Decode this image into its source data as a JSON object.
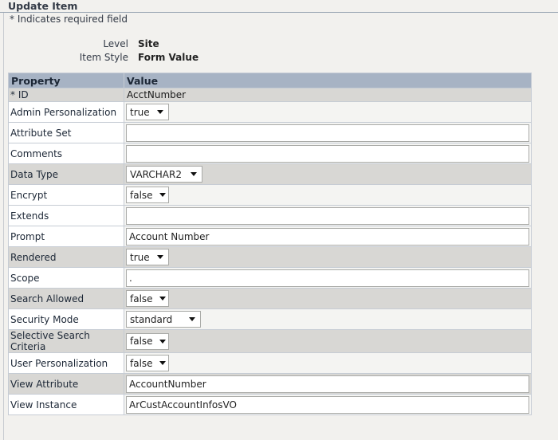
{
  "page": {
    "title": "Update Item",
    "required_note": "* Indicates required field"
  },
  "meta": {
    "level_label": "Level",
    "level_value": "Site",
    "style_label": "Item Style",
    "style_value": "Form Value"
  },
  "table": {
    "headers": [
      "Property",
      "Value"
    ],
    "rows": [
      {
        "property": "* ID",
        "value": "AcctNumber"
      },
      {
        "property": "Admin Personalization",
        "value": "true"
      },
      {
        "property": "Attribute Set",
        "value": ""
      },
      {
        "property": "Comments",
        "value": ""
      },
      {
        "property": "Data Type",
        "value": "VARCHAR2"
      },
      {
        "property": "Encrypt",
        "value": "false"
      },
      {
        "property": "Extends",
        "value": ""
      },
      {
        "property": "Prompt",
        "value": "Account Number"
      },
      {
        "property": "Rendered",
        "value": "true"
      },
      {
        "property": "Scope",
        "value": "."
      },
      {
        "property": "Search Allowed",
        "value": "false"
      },
      {
        "property": "Security Mode",
        "value": "standard"
      },
      {
        "property": "Selective Search Criteria",
        "value": "false"
      },
      {
        "property": "User Personalization",
        "value": "false"
      },
      {
        "property": "View Attribute",
        "value": "AccountNumber"
      },
      {
        "property": "View Instance",
        "value": "ArCustAccountInfosVO"
      }
    ]
  }
}
